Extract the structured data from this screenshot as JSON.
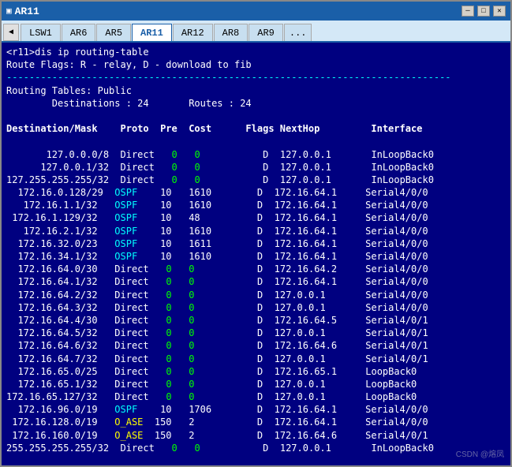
{
  "window": {
    "title": "AR11",
    "icon": "AR11"
  },
  "tabs": [
    {
      "label": "LSW1",
      "active": false
    },
    {
      "label": "AR6",
      "active": false
    },
    {
      "label": "AR5",
      "active": false
    },
    {
      "label": "AR11",
      "active": true
    },
    {
      "label": "AR12",
      "active": false
    },
    {
      "label": "AR8",
      "active": false
    },
    {
      "label": "AR9",
      "active": false
    },
    {
      "label": "...",
      "active": false
    }
  ],
  "terminal": {
    "command": "<r11>dis ip routing-table",
    "flags_line": "Route Flags: R - relay, D - download to fib",
    "separator": "------------------------------------------------------------------------------",
    "table_header": "Routing Tables: Public",
    "destinations_label": "Destinations :",
    "destinations_value": "24",
    "routes_label": "Routes :",
    "routes_value": "24",
    "col_headers": "Destination/Mask    Proto  Pre  Cost      Flags NextHop         Interface",
    "routes": [
      {
        "dest": "127.0.0.0/8",
        "proto": "Direct",
        "pre": "0",
        "cost": "0",
        "flag": "D",
        "nexthop": "127.0.0.1",
        "iface": "InLoopBack0"
      },
      {
        "dest": "127.0.0.1/32",
        "proto": "Direct",
        "pre": "0",
        "cost": "0",
        "flag": "D",
        "nexthop": "127.0.0.1",
        "iface": "InLoopBack0"
      },
      {
        "dest": "127.255.255.255/32",
        "proto": "Direct",
        "pre": "0",
        "cost": "0",
        "flag": "D",
        "nexthop": "127.0.0.1",
        "iface": "InLoopBack0"
      },
      {
        "dest": "172.16.0.128/29",
        "proto": "OSPF",
        "pre": "10",
        "cost": "1610",
        "flag": "D",
        "nexthop": "172.16.64.1",
        "iface": "Serial4/0/0"
      },
      {
        "dest": "172.16.1.1/32",
        "proto": "OSPF",
        "pre": "10",
        "cost": "1610",
        "flag": "D",
        "nexthop": "172.16.64.1",
        "iface": "Serial4/0/0"
      },
      {
        "dest": "172.16.1.129/32",
        "proto": "OSPF",
        "pre": "10",
        "cost": "48",
        "flag": "D",
        "nexthop": "172.16.64.1",
        "iface": "Serial4/0/0"
      },
      {
        "dest": "172.16.2.1/32",
        "proto": "OSPF",
        "pre": "10",
        "cost": "1610",
        "flag": "D",
        "nexthop": "172.16.64.1",
        "iface": "Serial4/0/0"
      },
      {
        "dest": "172.16.32.0/23",
        "proto": "OSPF",
        "pre": "10",
        "cost": "1611",
        "flag": "D",
        "nexthop": "172.16.64.1",
        "iface": "Serial4/0/0"
      },
      {
        "dest": "172.16.34.1/32",
        "proto": "OSPF",
        "pre": "10",
        "cost": "1610",
        "flag": "D",
        "nexthop": "172.16.64.1",
        "iface": "Serial4/0/0"
      },
      {
        "dest": "172.16.64.0/30",
        "proto": "Direct",
        "pre": "0",
        "cost": "0",
        "flag": "D",
        "nexthop": "172.16.64.2",
        "iface": "Serial4/0/0"
      },
      {
        "dest": "172.16.64.1/32",
        "proto": "Direct",
        "pre": "0",
        "cost": "0",
        "flag": "D",
        "nexthop": "172.16.64.1",
        "iface": "Serial4/0/0"
      },
      {
        "dest": "172.16.64.2/32",
        "proto": "Direct",
        "pre": "0",
        "cost": "0",
        "flag": "D",
        "nexthop": "127.0.0.1",
        "iface": "Serial4/0/0"
      },
      {
        "dest": "172.16.64.3/32",
        "proto": "Direct",
        "pre": "0",
        "cost": "0",
        "flag": "D",
        "nexthop": "127.0.0.1",
        "iface": "Serial4/0/0"
      },
      {
        "dest": "172.16.64.4/30",
        "proto": "Direct",
        "pre": "0",
        "cost": "0",
        "flag": "D",
        "nexthop": "172.16.64.5",
        "iface": "Serial4/0/1"
      },
      {
        "dest": "172.16.64.5/32",
        "proto": "Direct",
        "pre": "0",
        "cost": "0",
        "flag": "D",
        "nexthop": "127.0.0.1",
        "iface": "Serial4/0/1"
      },
      {
        "dest": "172.16.64.6/32",
        "proto": "Direct",
        "pre": "0",
        "cost": "0",
        "flag": "D",
        "nexthop": "172.16.64.6",
        "iface": "Serial4/0/1"
      },
      {
        "dest": "172.16.64.7/32",
        "proto": "Direct",
        "pre": "0",
        "cost": "0",
        "flag": "D",
        "nexthop": "127.0.0.1",
        "iface": "Serial4/0/1"
      },
      {
        "dest": "172.16.65.0/25",
        "proto": "Direct",
        "pre": "0",
        "cost": "0",
        "flag": "D",
        "nexthop": "172.16.65.1",
        "iface": "LoopBack0"
      },
      {
        "dest": "172.16.65.1/32",
        "proto": "Direct",
        "pre": "0",
        "cost": "0",
        "flag": "D",
        "nexthop": "127.0.0.1",
        "iface": "LoopBack0"
      },
      {
        "dest": "172.16.65.127/32",
        "proto": "Direct",
        "pre": "0",
        "cost": "0",
        "flag": "D",
        "nexthop": "127.0.0.1",
        "iface": "LoopBack0"
      },
      {
        "dest": "172.16.96.0/19",
        "proto": "OSPF",
        "pre": "10",
        "cost": "1706",
        "flag": "D",
        "nexthop": "172.16.64.1",
        "iface": "Serial4/0/0"
      },
      {
        "dest": "172.16.128.0/19",
        "proto": "O_ASE",
        "pre": "150",
        "cost": "2",
        "flag": "D",
        "nexthop": "172.16.64.1",
        "iface": "Serial4/0/0"
      },
      {
        "dest": "172.16.160.0/19",
        "proto": "O_ASE",
        "pre": "150",
        "cost": "2",
        "flag": "D",
        "nexthop": "172.16.64.6",
        "iface": "Serial4/0/1"
      },
      {
        "dest": "255.255.255.255/32",
        "proto": "Direct",
        "pre": "0",
        "cost": "0",
        "flag": "D",
        "nexthop": "127.0.0.1",
        "iface": "InLoopBack0"
      }
    ]
  },
  "watermark": "CSDN @熔凤"
}
